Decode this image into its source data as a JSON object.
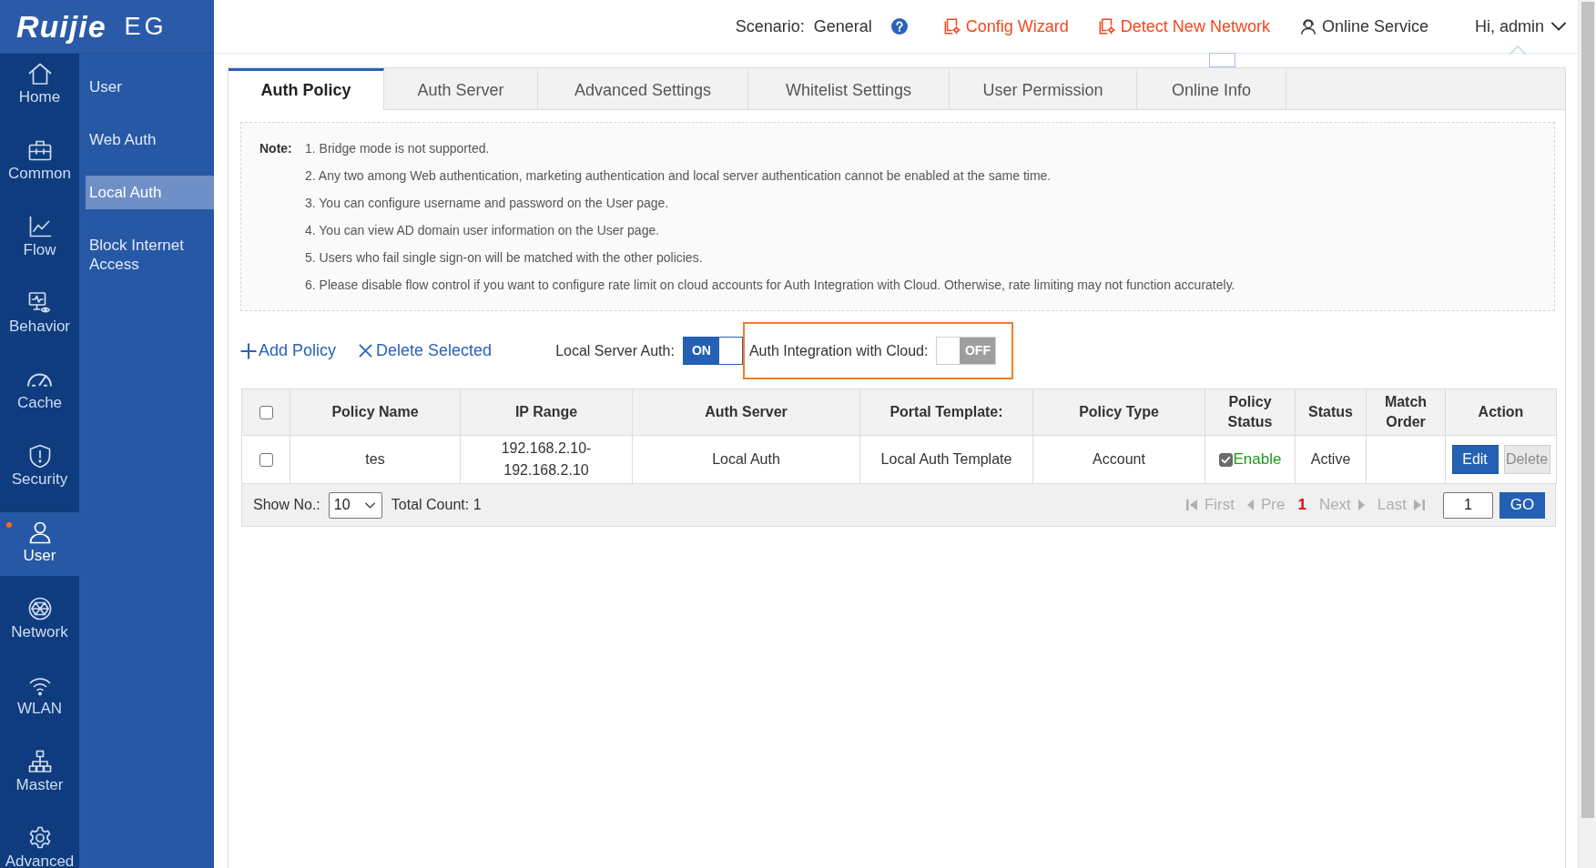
{
  "logo": {
    "brand": "Ruijie",
    "product": "EG"
  },
  "nav_rail": [
    {
      "label": "Home",
      "selected": false,
      "notice": false
    },
    {
      "label": "Common",
      "selected": false,
      "notice": false
    },
    {
      "label": "Flow",
      "selected": false,
      "notice": false
    },
    {
      "label": "Behavior",
      "selected": false,
      "notice": false
    },
    {
      "label": "Cache",
      "selected": false,
      "notice": false
    },
    {
      "label": "Security",
      "selected": false,
      "notice": false
    },
    {
      "label": "User",
      "selected": true,
      "notice": true
    },
    {
      "label": "Network",
      "selected": false,
      "notice": false
    },
    {
      "label": "WLAN",
      "selected": false,
      "notice": false
    },
    {
      "label": "Master",
      "selected": false,
      "notice": false
    },
    {
      "label": "Advanced",
      "selected": false,
      "notice": false
    }
  ],
  "submenu": [
    {
      "label": "User",
      "selected": false
    },
    {
      "label": "Web Auth",
      "selected": false
    },
    {
      "label": "Local Auth",
      "selected": true
    },
    {
      "label": "Block Internet Access",
      "selected": false
    }
  ],
  "top_bar": {
    "scenario_label": "Scenario:",
    "scenario_value": "General",
    "links": [
      {
        "label": "Config Wizard",
        "kind": "wizard"
      },
      {
        "label": "Detect New Network",
        "kind": "wizard"
      },
      {
        "label": "Online Service",
        "kind": "service"
      }
    ],
    "user_menu": "Hi, admin"
  },
  "tabs": [
    {
      "label": "Auth Policy",
      "selected": true
    },
    {
      "label": "Auth Server",
      "selected": false
    },
    {
      "label": "Advanced Settings",
      "selected": false
    },
    {
      "label": "Whitelist Settings",
      "selected": false
    },
    {
      "label": "User Permission",
      "selected": false
    },
    {
      "label": "Online Info",
      "selected": false
    }
  ],
  "note": {
    "label": "Note:",
    "items": [
      "1. Bridge mode is not supported.",
      "2. Any two among Web authentication, marketing authentication and local server authentication cannot be enabled at the same time.",
      "3. You can configure username and password on the User page.",
      "4. You can view AD domain user information on the User page.",
      "5. Users who fail single sign-on will be matched with the other policies.",
      "6. Please disable flow control if you want to configure rate limit on cloud accounts for Auth Integration with Cloud. Otherwise, rate limiting may not function accurately."
    ]
  },
  "toolbar": {
    "actions": [
      {
        "label": "Add Policy",
        "kind": "add"
      },
      {
        "label": "Delete Selected",
        "kind": "delete"
      }
    ],
    "switches": [
      {
        "label": "Local Server Auth:",
        "on": true,
        "state_text": "ON",
        "highlighted": false
      },
      {
        "label": "Auth Integration with Cloud:",
        "on": false,
        "state_text": "OFF",
        "highlighted": true
      }
    ]
  },
  "table": {
    "select_all_checked": false,
    "columns": [
      "Policy Name",
      "IP Range",
      "Auth Server",
      "Portal Template:",
      "Policy Type",
      "Policy Status",
      "Status",
      "Match Order",
      "Action"
    ],
    "rows": [
      {
        "checked": false,
        "policy_name": "tes",
        "ip_range": [
          "192.168.2.10-",
          "192.168.2.10"
        ],
        "auth_server": "Local Auth",
        "portal_template": "Local Auth Template",
        "policy_type": "Account",
        "policy_status": {
          "checked": true,
          "label": "Enable"
        },
        "status": "Active",
        "actions": [
          {
            "label": "Edit",
            "disabled": false
          },
          {
            "label": "Delete",
            "disabled": true
          }
        ]
      }
    ]
  },
  "footer": {
    "show_label": "Show No.:",
    "page_size": "10",
    "total": "Total Count: 1",
    "pages": [
      {
        "label": "First",
        "kind": "first",
        "selected": false,
        "disabled": true
      },
      {
        "label": "Pre",
        "kind": "prev",
        "selected": false,
        "disabled": true
      },
      {
        "label": "1",
        "kind": "page",
        "selected": true
      },
      {
        "label": "Next",
        "kind": "next",
        "selected": false,
        "disabled": true
      },
      {
        "label": "Last",
        "kind": "last",
        "selected": false,
        "disabled": true
      }
    ],
    "page_input": "1",
    "go": "GO"
  }
}
